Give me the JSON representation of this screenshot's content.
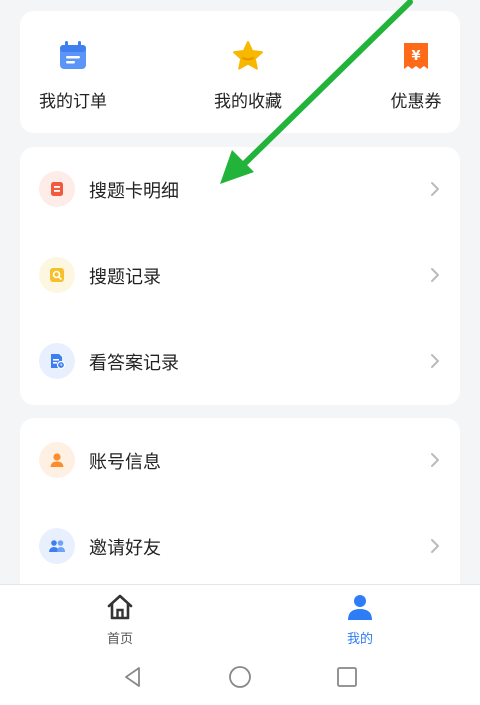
{
  "quick_actions": [
    {
      "label": "我的订单",
      "icon": "calendar-order-icon",
      "color": "#4f8ef7"
    },
    {
      "label": "我的收藏",
      "icon": "star-icon",
      "color": "#f7b500"
    },
    {
      "label": "优惠券",
      "icon": "coupon-yuan-icon",
      "color": "#ff6a1a",
      "glyph": "¥"
    }
  ],
  "menu": [
    {
      "label": "搜题卡明细",
      "icon": "card-detail-icon",
      "color": "#f15a3c",
      "bg": "#fdece7"
    },
    {
      "label": "搜题记录",
      "icon": "search-record-icon",
      "color": "#f6c02a",
      "bg": "#fdf6e1"
    },
    {
      "label": "看答案记录",
      "icon": "answer-record-icon",
      "color": "#3d7ef2",
      "bg": "#e8f0fd"
    }
  ],
  "account": [
    {
      "label": "账号信息",
      "icon": "user-icon",
      "color": "#ff8c2a",
      "bg": "#fef0e3"
    },
    {
      "label": "邀请好友",
      "icon": "friends-icon",
      "color": "#3d7ef2",
      "bg": "#e8f0fd"
    }
  ],
  "tabbar": {
    "home_label": "首页",
    "mine_label": "我的",
    "active_color": "#2f7df6"
  },
  "annotation_color": "#22b33a"
}
